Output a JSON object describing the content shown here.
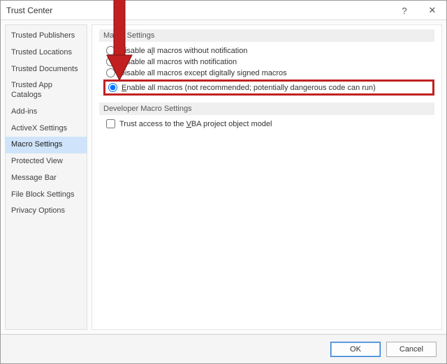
{
  "window": {
    "title": "Trust Center",
    "help_label": "?",
    "close_label": "✕"
  },
  "sidebar": {
    "items": [
      {
        "label": "Trusted Publishers"
      },
      {
        "label": "Trusted Locations"
      },
      {
        "label": "Trusted Documents"
      },
      {
        "label": "Trusted App Catalogs"
      },
      {
        "label": "Add-ins"
      },
      {
        "label": "ActiveX Settings"
      },
      {
        "label": "Macro Settings",
        "selected": true
      },
      {
        "label": "Protected View"
      },
      {
        "label": "Message Bar"
      },
      {
        "label": "File Block Settings"
      },
      {
        "label": "Privacy Options"
      }
    ]
  },
  "content": {
    "macro_group_title": "Macro Settings",
    "radios": {
      "r1": {
        "pre": "Disable a",
        "hot": "l",
        "post": "l macros without notification"
      },
      "r2": {
        "pre": "",
        "hot": "D",
        "post": "isable all macros with notification"
      },
      "r3": {
        "pre": "Disable all macros except di",
        "hot": "g",
        "post": "itally signed macros"
      },
      "r4": {
        "pre": "",
        "hot": "E",
        "post": "nable all macros (not recommended; potentially dangerous code can run)"
      }
    },
    "selected_radio": "r4",
    "dev_group_title": "Developer Macro Settings",
    "trust_vba": {
      "pre": "Trust access to the ",
      "hot": "V",
      "post": "BA project object model"
    }
  },
  "footer": {
    "ok_label": "OK",
    "cancel_label": "Cancel"
  },
  "annotation": {
    "arrow_color": "#c22020"
  }
}
